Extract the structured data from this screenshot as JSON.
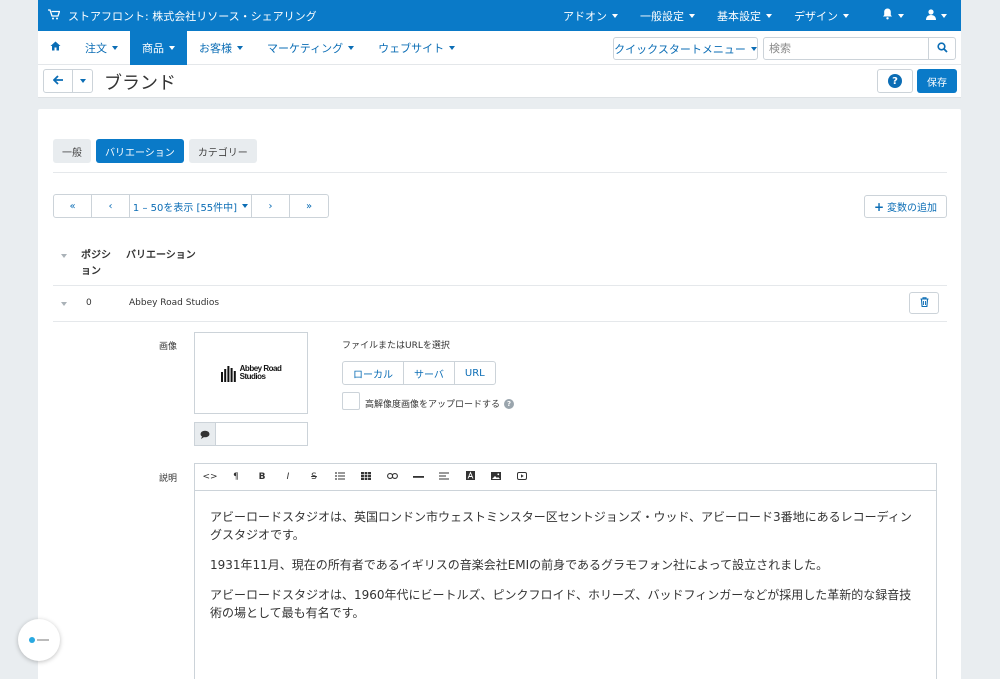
{
  "topbar": {
    "store_name": "ストアフロント: 株式会社リソース・シェアリング",
    "menus": [
      "アドオン",
      "一般設定",
      "基本設定",
      "デザイン"
    ]
  },
  "nav": {
    "items": [
      "注文",
      "商品",
      "お客様",
      "マーケティング",
      "ウェブサイト"
    ],
    "active": "商品",
    "quick_menu": "クイックスタートメニュー",
    "search_placeholder": "検索"
  },
  "page": {
    "title": "ブランド",
    "save_label": "保存"
  },
  "tabs": [
    "一般",
    "バリエーション",
    "カテゴリー"
  ],
  "pager": {
    "first": "«",
    "prev": "‹",
    "range": "1 – 50を表示 [55件中]",
    "next": "›",
    "last": "»"
  },
  "add_variant_label": "変数の追加",
  "table": {
    "col_position": "ポジション",
    "col_variant": "バリエーション",
    "row": {
      "position": "0",
      "name": "Abbey Road Studios"
    }
  },
  "image": {
    "label": "画像",
    "logo_line1": "Abbey Road",
    "logo_line2": "Studios",
    "alt_value": "",
    "file_label": "ファイルまたはURLを選択",
    "file_buttons": [
      "ローカル",
      "サーバ",
      "URL"
    ],
    "hires_label": "高解像度画像をアップロードする"
  },
  "description": {
    "label": "説明",
    "toolbar": [
      "<>",
      "¶",
      "B",
      "I",
      "S",
      "list-icon",
      "table-icon",
      "link-icon",
      "hr-icon",
      "align-icon",
      "color-icon",
      "image-icon",
      "video-icon"
    ],
    "paragraphs": [
      "アビーロードスタジオは、英国ロンドン市ウェストミンスター区セントジョンズ・ウッド、アビーロード3番地にあるレコーディングスタジオです。",
      "1931年11月、現在の所有者であるイギリスの音楽会社EMIの前身であるグラモフォン社によって設立されました。",
      "アビーロードスタジオは、1960年代にビートルズ、ピンクフロイド、ホリーズ、バッドフィンガーなどが採用した革新的な録音技術の場として最も有名です。"
    ]
  },
  "colors": {
    "accent": "#0a7ac8",
    "link": "#0b6db5",
    "background": "#e9edf0"
  }
}
